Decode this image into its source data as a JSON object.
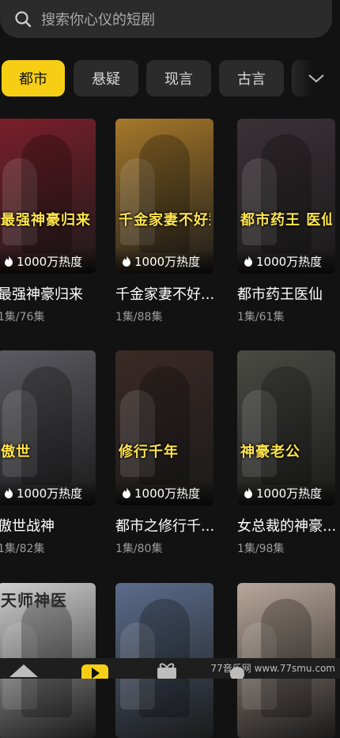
{
  "search": {
    "placeholder": "搜索你心仪的短剧"
  },
  "tabs": [
    {
      "label": "都市"
    },
    {
      "label": "悬疑"
    },
    {
      "label": "现言"
    },
    {
      "label": "古言"
    },
    {
      "label": ""
    }
  ],
  "dramas": [
    {
      "title": "最强神豪归来",
      "episodes": "1集/76集",
      "heat": "1000万热度",
      "poster_text": "最强神豪归来",
      "bg": "#7a1f2a"
    },
    {
      "title": "千金家妻不好...",
      "episodes": "1集/88集",
      "heat": "1000万热度",
      "poster_text": "千金家妻不好惹",
      "bg": "#a6782a"
    },
    {
      "title": "都市药王医仙",
      "episodes": "1集/61集",
      "heat": "1000万热度",
      "poster_text": "都市药王 医仙",
      "bg": "#3b3136"
    },
    {
      "title": "傲世战神",
      "episodes": "1集/82集",
      "heat": "1000万热度",
      "poster_text": "傲世",
      "bg": "#5a5a60"
    },
    {
      "title": "都市之修行千...",
      "episodes": "1集/80集",
      "heat": "1000万热度",
      "poster_text": "修行千年",
      "bg": "#3a2a26"
    },
    {
      "title": "女总裁的神豪...",
      "episodes": "1集/98集",
      "heat": "1000万热度",
      "poster_text": "神豪老公",
      "bg": "#4a4a44"
    },
    {
      "title": "",
      "episodes": "",
      "heat": "",
      "poster_text": "天师神医",
      "bg": "#cfcfd0"
    },
    {
      "title": "",
      "episodes": "",
      "heat": "",
      "poster_text": "",
      "bg": "#5b6d8c"
    },
    {
      "title": "",
      "episodes": "",
      "heat": "",
      "poster_text": "",
      "bg": "#b9a79a"
    }
  ],
  "bottom_nav": [
    {
      "icon": "home-icon"
    },
    {
      "icon": "play-icon"
    },
    {
      "icon": "gift-icon"
    },
    {
      "icon": "profile-icon"
    }
  ],
  "watermark": "77音乐网 www.77smu.com",
  "colors": {
    "accent": "#f6cf15",
    "background": "#121212",
    "chip": "#2b2b2b"
  }
}
